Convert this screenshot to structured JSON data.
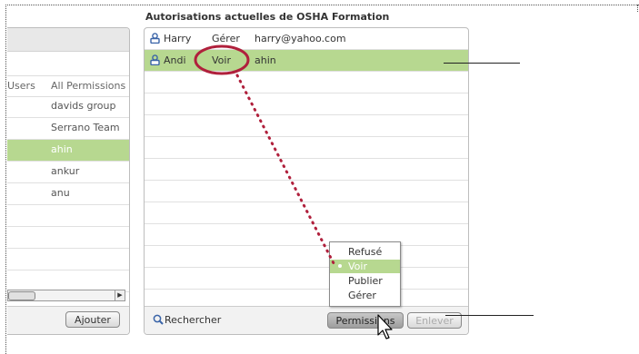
{
  "left_panel": {
    "columns": [
      "Users",
      "All Permissions"
    ],
    "groups": [
      "davids group",
      "Serrano Team",
      "ahin",
      "ankur",
      "anu"
    ],
    "selected_index": 2,
    "add_button": "Ajouter"
  },
  "right_panel": {
    "title": "Autorisations actuelles de OSHA Formation",
    "rows": [
      {
        "name": "Harry",
        "permission": "Gérer",
        "email": "harry@yahoo.com"
      },
      {
        "name": "Andi",
        "permission": "Voir",
        "email": "ahin"
      }
    ],
    "search_label": "Rechercher",
    "permissions_button": "Permissions",
    "remove_button": "Enlever"
  },
  "dropdown": {
    "options": [
      "Refusé",
      "Voir",
      "Publier",
      "Gérer"
    ],
    "selected": "Voir"
  },
  "colors": {
    "selection_green": "#b7d890",
    "callout_red": "#b0203c"
  },
  "icons": [
    "user-icon",
    "search-icon",
    "mouse-pointer-icon"
  ]
}
